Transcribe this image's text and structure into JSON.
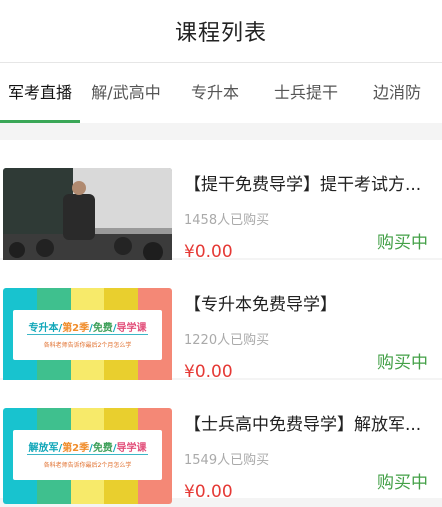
{
  "header": {
    "title": "课程列表"
  },
  "tabs": [
    {
      "label": "军考直播",
      "active": true
    },
    {
      "label": "解/武高中",
      "active": false
    },
    {
      "label": "专升本",
      "active": false
    },
    {
      "label": "士兵提干",
      "active": false
    },
    {
      "label": "边消防",
      "active": false
    }
  ],
  "colors": {
    "accent_green": "#3aa757",
    "price_red": "#e53935",
    "buy_green": "#43a047"
  },
  "courses": [
    {
      "title": "【提干免费导学】提干考试方...",
      "buyers": "1458人已购买",
      "price": "¥0.00",
      "action": "购买中",
      "thumb": "classroom-photo"
    },
    {
      "title": "【专升本免费导学】",
      "buyers": "1220人已购买",
      "price": "¥0.00",
      "action": "购买中",
      "thumb": "promo-banner",
      "banner": {
        "w1": "专升本",
        "sep": "/",
        "w2": "第2季",
        "w3": "免费",
        "w4": "导学课",
        "sub": "各科老师告诉你最后2个月怎么学"
      }
    },
    {
      "title": "【士兵高中免费导学】解放军...",
      "buyers": "1549人已购买",
      "price": "¥0.00",
      "action": "购买中",
      "thumb": "promo-banner",
      "banner": {
        "w1": "解放军",
        "sep": "/",
        "w2": "第2季",
        "w3": "免费",
        "w4": "导学课",
        "sub": "各科老师告诉你最后2个月怎么学"
      }
    }
  ]
}
